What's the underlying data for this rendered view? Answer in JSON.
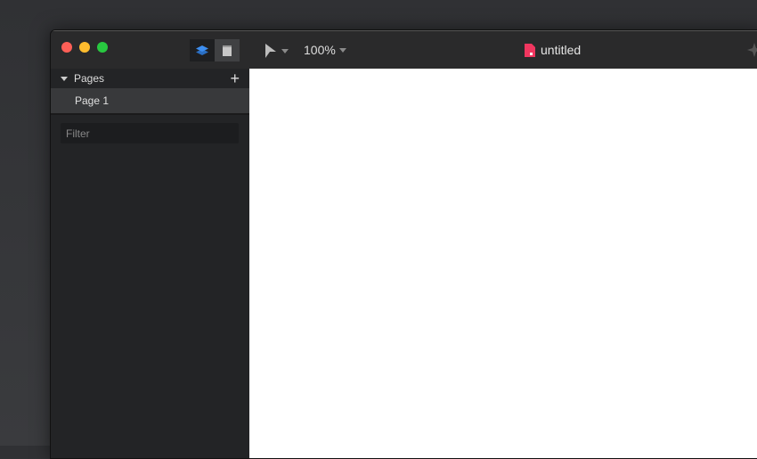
{
  "toolbar": {
    "zoom_level": "100%",
    "document_title": "untitled"
  },
  "sidebar": {
    "pages_header": "Pages",
    "pages": [
      {
        "label": "Page 1"
      }
    ],
    "filter_placeholder": "Filter"
  },
  "colors": {
    "accent": "#3d8ef0",
    "document_icon": "#f0365f",
    "close": "#fe5f57",
    "minimize": "#febc2e",
    "zoom": "#28c840"
  }
}
